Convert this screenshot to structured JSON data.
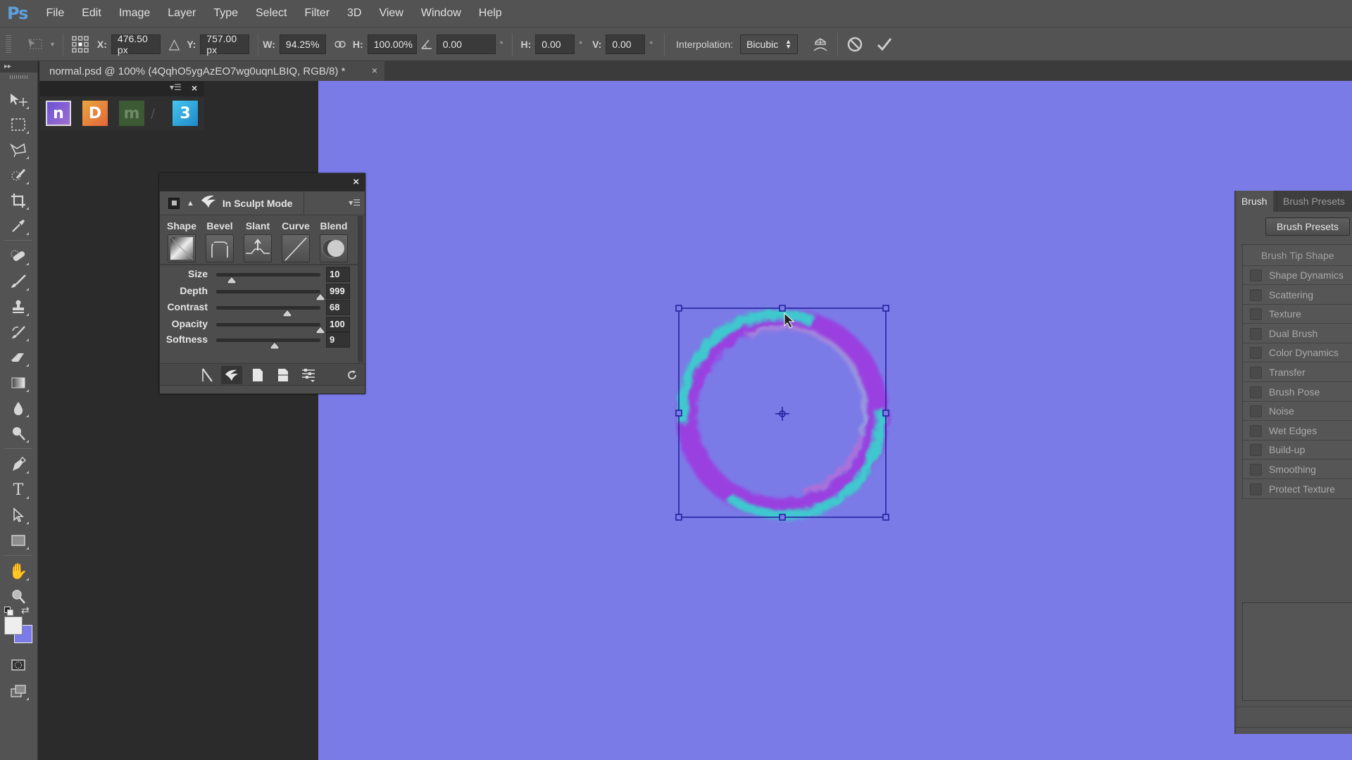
{
  "app": {
    "logo": "Ps"
  },
  "menu": [
    "File",
    "Edit",
    "Image",
    "Layer",
    "Type",
    "Select",
    "Filter",
    "3D",
    "View",
    "Window",
    "Help"
  ],
  "options": {
    "x_label": "X:",
    "x_value": "476.50 px",
    "y_label": "Y:",
    "y_value": "757.00 px",
    "w_label": "W:",
    "w_value": "94.25%",
    "h_label": "H:",
    "h_value": "100.00%",
    "angle_value": "0.00",
    "degree": "°",
    "hskew_label": "H:",
    "hskew_value": "0.00",
    "vskew_label": "V:",
    "vskew_value": "0.00",
    "interpolation_label": "Interpolation:",
    "interpolation_value": "Bicubic"
  },
  "document_tab": {
    "title": "normal.psd @ 100% (4QqhO5ygAzEO7wg0uqnLBIQ, RGB/8) *",
    "close": "×"
  },
  "plugin_panel": {
    "icons": [
      "n",
      "D",
      "m",
      "/",
      "3"
    ]
  },
  "sculpt_panel": {
    "mode_label": "In Sculpt Mode",
    "presets": [
      "Shape",
      "Bevel",
      "Slant",
      "Curve",
      "Blend"
    ],
    "sliders": [
      {
        "label": "Size",
        "value": "10",
        "position": 0.15
      },
      {
        "label": "Depth",
        "value": "999",
        "position": 1.0
      },
      {
        "label": "Contrast",
        "value": "68",
        "position": 0.68
      },
      {
        "label": "Opacity",
        "value": "100",
        "position": 1.0
      },
      {
        "label": "Softness",
        "value": "9",
        "position": 0.56
      }
    ]
  },
  "brush_panel": {
    "tabs": [
      "Brush",
      "Brush Presets"
    ],
    "presets_button": "Brush Presets",
    "tip_shape": "Brush Tip Shape",
    "options": [
      "Shape Dynamics",
      "Scattering",
      "Texture",
      "Dual Brush",
      "Color Dynamics",
      "Transfer",
      "Brush Pose",
      "Noise",
      "Wet Edges",
      "Build-up",
      "Smoothing",
      "Protect Texture"
    ]
  },
  "colors": {
    "canvas": "#7b7be8",
    "foreground": "#eeeeee",
    "background": "#7b7be8"
  }
}
